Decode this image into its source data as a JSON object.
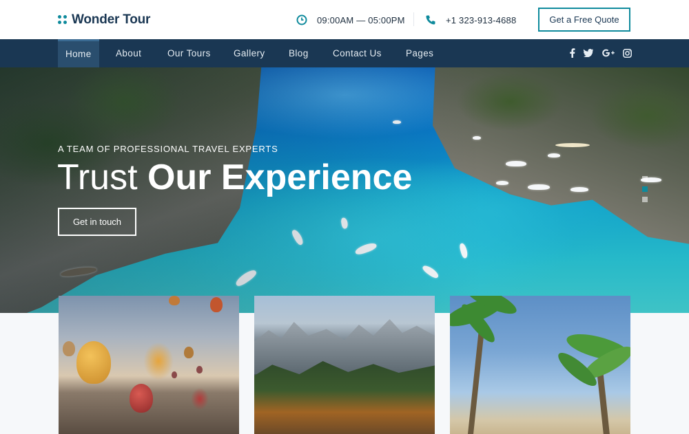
{
  "brand": {
    "name": "Wonder Tour",
    "accent": "#0e8a9c",
    "navy": "#1a3753"
  },
  "header": {
    "hours": "09:00AM — 05:00PM",
    "phone": "+1 323-913-4688",
    "quote_button": "Get a Free Quote",
    "hours_icon": "clock-icon",
    "phone_icon": "phone-icon"
  },
  "nav": {
    "items": [
      "Home",
      "About",
      "Our Tours",
      "Gallery",
      "Blog",
      "Contact Us",
      "Pages"
    ],
    "active": "Home",
    "social": [
      {
        "icon": "facebook-icon",
        "glyph": "f"
      },
      {
        "icon": "twitter-icon",
        "glyph": "t"
      },
      {
        "icon": "google-plus-icon",
        "glyph": "G+"
      },
      {
        "icon": "instagram-icon",
        "glyph": "ig"
      }
    ]
  },
  "hero": {
    "eyebrow": "A TEAM OF PROFESSIONAL TRAVEL EXPERTS",
    "title_light": "Trust",
    "title_bold": "Our Experience",
    "button": "Get in touch",
    "slides": 3,
    "active_slide": 2
  },
  "cards": [
    {
      "image": "hot-air-balloons"
    },
    {
      "image": "mountain-forest"
    },
    {
      "image": "palm-trees"
    }
  ]
}
